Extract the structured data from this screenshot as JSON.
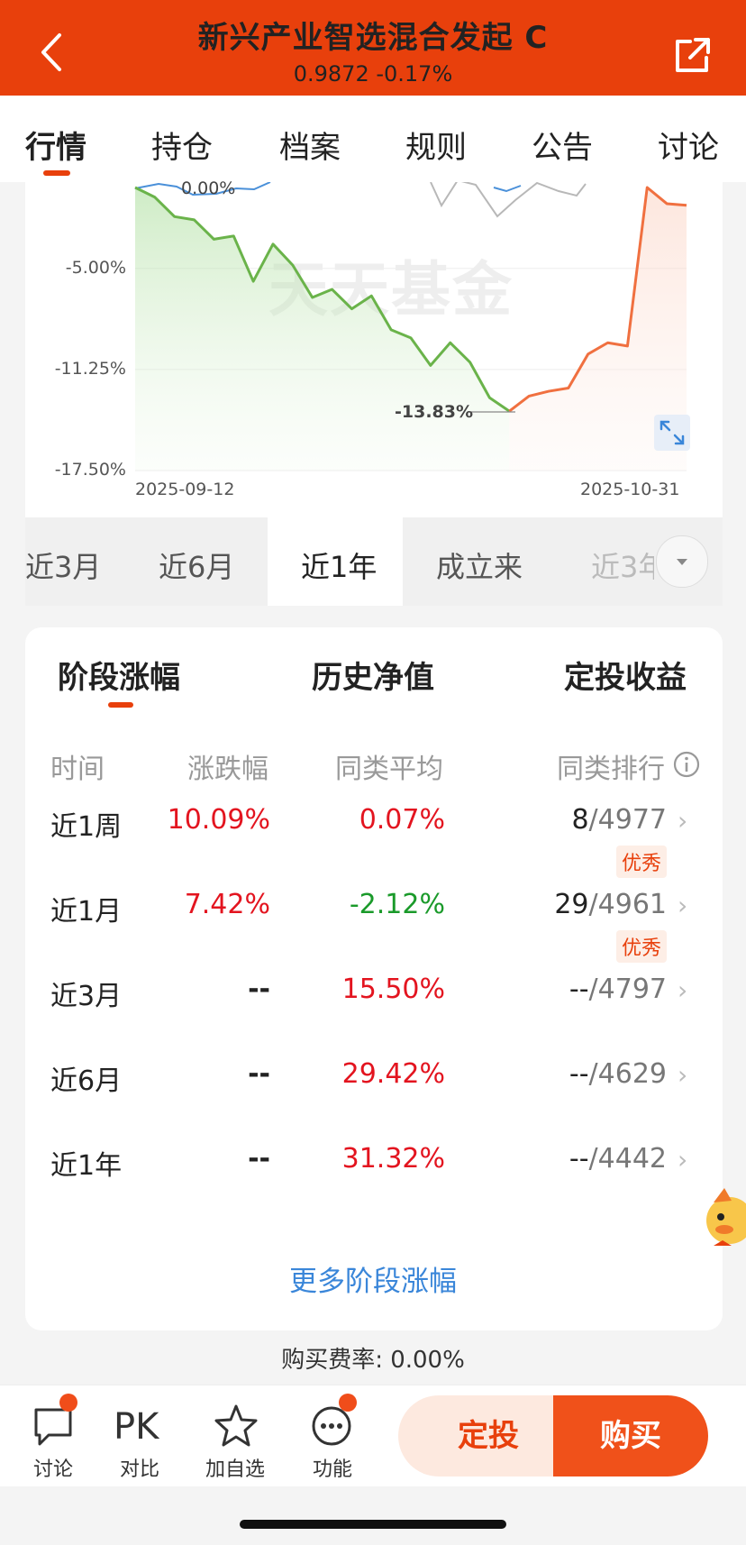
{
  "header": {
    "title": "新兴产业智选混合发起 C",
    "subtitle": "0.9872 -0.17%"
  },
  "tabs": [
    "行情",
    "持仓",
    "档案",
    "规则",
    "公告",
    "讨论"
  ],
  "chart": {
    "y_labels": [
      "0.00%",
      "-5.00%",
      "-11.25%",
      "-17.50%"
    ],
    "x_labels": [
      "2025-09-12",
      "2025-10-31"
    ],
    "min_label": "-13.83%",
    "watermark": "天天基金"
  },
  "chart_data": {
    "type": "line",
    "x": [
      "2025-09-12",
      "2025-10-31"
    ],
    "series": [
      {
        "values": [
          0.0,
          -0.6,
          -1.8,
          -2.0,
          -3.2,
          -3.0,
          -5.8,
          -3.5,
          -4.8,
          -6.8,
          -6.3,
          -7.5,
          -6.7,
          -8.8,
          -9.3,
          -11.0,
          -9.6,
          -10.8,
          -13.0,
          -13.83
        ],
        "color": "#6ab34a"
      },
      {
        "values": [
          -13.83,
          -12.9,
          -12.6,
          -12.4,
          -10.3,
          -9.6,
          -9.8,
          0.0,
          -1.0,
          -1.1
        ],
        "color": "#f07040"
      }
    ],
    "ylim": [
      -17.5,
      0
    ]
  },
  "ranges": [
    "近3月",
    "近6月",
    "近1年",
    "成立来",
    "近3年"
  ],
  "stats": {
    "tabs": [
      "阶段涨幅",
      "历史净值",
      "定投收益"
    ],
    "headers": [
      "时间",
      "涨跌幅",
      "同类平均",
      "同类排行"
    ],
    "rows": [
      {
        "period": "近1周",
        "change": "10.09%",
        "avg": "0.07%",
        "rank": "8",
        "total": "/4977",
        "badge": "优秀"
      },
      {
        "period": "近1月",
        "change": "7.42%",
        "avg": "-2.12%",
        "rank": "29",
        "total": "/4961",
        "badge": "优秀"
      },
      {
        "period": "近3月",
        "change": "--",
        "avg": "15.50%",
        "rank": "--",
        "total": "/4797",
        "badge": ""
      },
      {
        "period": "近6月",
        "change": "--",
        "avg": "29.42%",
        "rank": "--",
        "total": "/4629",
        "badge": ""
      },
      {
        "period": "近1年",
        "change": "--",
        "avg": "31.32%",
        "rank": "--",
        "total": "/4442",
        "badge": ""
      }
    ],
    "more": "更多阶段涨幅"
  },
  "fee": "购买费率: 0.00%",
  "bottom": {
    "discuss": "讨论",
    "pk_icon_text": "PK",
    "compare": "对比",
    "watch": "加自选",
    "functions": "功能",
    "dingtou": "定投",
    "buy": "购买"
  },
  "colors": {
    "brand": "#e8400c",
    "up": "#e3141f",
    "down": "#1a9a2a",
    "link": "#3a86d9"
  }
}
